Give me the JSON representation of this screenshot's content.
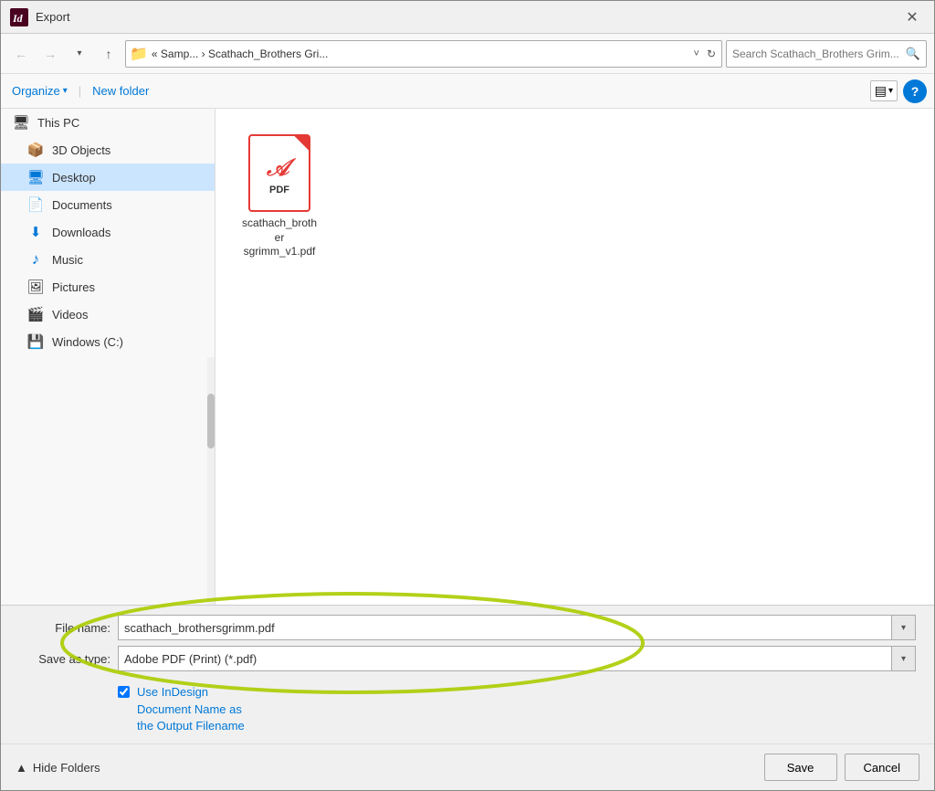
{
  "titlebar": {
    "app_icon": "InDesign",
    "title": "Export",
    "close_label": "✕"
  },
  "toolbar": {
    "back_label": "←",
    "forward_label": "→",
    "dropdown_label": "▾",
    "up_label": "↑",
    "address_icon": "📁",
    "address_path": "« Samp... › Scathach_Brothers Gri...",
    "address_chevron": "˅",
    "address_refresh": "↻",
    "search_placeholder": "Search Scathach_Brothers Grim...",
    "search_icon": "🔍"
  },
  "toolbar2": {
    "organize_label": "Organize",
    "organize_chevron": "▾",
    "new_folder_label": "New folder",
    "view_icon": "▤",
    "view_chevron": "▾",
    "help_label": "?"
  },
  "sidebar": {
    "items": [
      {
        "id": "this-pc",
        "label": "This PC",
        "icon": "thispc",
        "active": false
      },
      {
        "id": "3d-objects",
        "label": "3D Objects",
        "icon": "3dobjects",
        "active": false
      },
      {
        "id": "desktop",
        "label": "Desktop",
        "icon": "desktop",
        "active": true
      },
      {
        "id": "documents",
        "label": "Documents",
        "icon": "documents",
        "active": false
      },
      {
        "id": "downloads",
        "label": "Downloads",
        "icon": "downloads",
        "active": false
      },
      {
        "id": "music",
        "label": "Music",
        "icon": "music",
        "active": false
      },
      {
        "id": "pictures",
        "label": "Pictures",
        "icon": "pictures",
        "active": false
      },
      {
        "id": "videos",
        "label": "Videos",
        "icon": "videos",
        "active": false
      },
      {
        "id": "windows-c",
        "label": "Windows (C:)",
        "icon": "windows",
        "active": false
      }
    ]
  },
  "content": {
    "files": [
      {
        "id": "pdf-file",
        "name": "scathach_brother\nsgrimm_v1.pdf",
        "type": "pdf"
      }
    ]
  },
  "form": {
    "file_name_label": "File name:",
    "file_name_value": "scathach_brothersgrimm.pdf",
    "save_type_label": "Save as type:",
    "save_type_value": "Adobe PDF (Print) (*.pdf)",
    "checkbox_label": "Use InDesign",
    "checkbox_subtext": "Document Name as\nthe Output Filename"
  },
  "footer": {
    "hide_folders_label": "Hide Folders",
    "hide_folders_chevron": "▲",
    "save_label": "Save",
    "cancel_label": "Cancel"
  }
}
